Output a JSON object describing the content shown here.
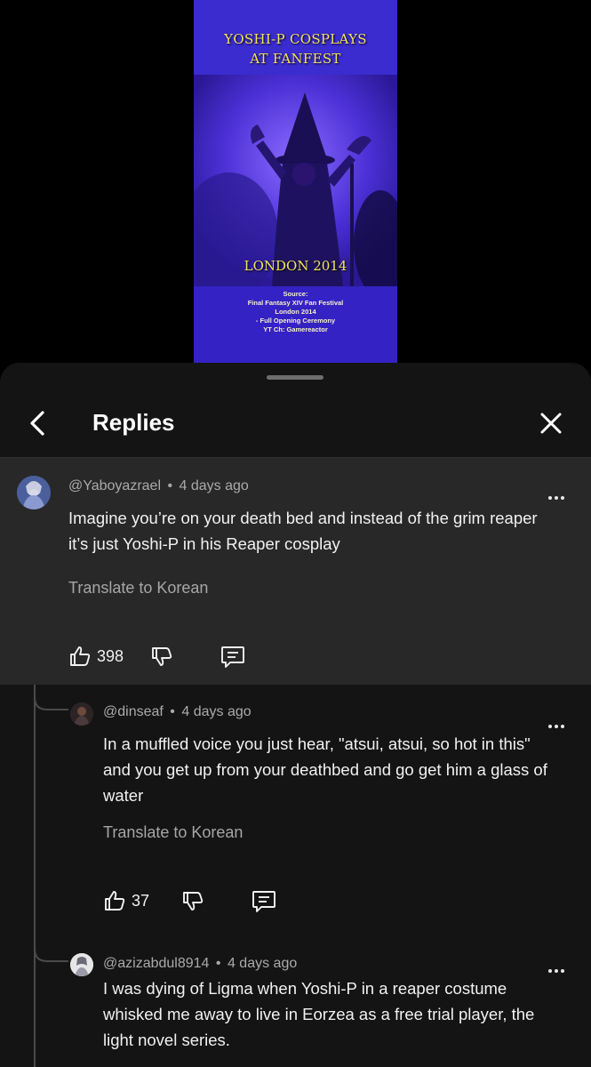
{
  "video": {
    "title_line1": "YOSHI-P COSPLAYS",
    "title_line2": "AT FANFEST",
    "location": "LONDON 2014",
    "source_lines": [
      "Source:",
      "Final Fantasy XIV Fan Festival",
      "London 2014",
      "- Full Opening Ceremony",
      "YT Ch: Gamereactor"
    ]
  },
  "header": {
    "title": "Replies"
  },
  "comment": {
    "author": "@Yaboyazrael",
    "time": "4 days ago",
    "text": "Imagine you’re on your death bed and instead of the grim reaper it’s just Yoshi-P in his Reaper cosplay",
    "translate": "Translate to Korean",
    "likes": "398"
  },
  "replies": [
    {
      "author": "@dinseaf",
      "time": "4 days ago",
      "text": "In a muffled voice you just hear, \"atsui, atsui, so hot in this\" and you get up from your deathbed and go get him a glass of water",
      "translate": "Translate to Korean",
      "likes": "37"
    },
    {
      "author": "@azizabdul8914",
      "time": "4 days ago",
      "text": "I was dying of Ligma when Yoshi-P in a reaper costume whisked me away to live in Eorzea as a free trial player, the light novel series."
    }
  ],
  "separator": "•",
  "colors": {
    "sheet": "#141414",
    "highlight": "#282828",
    "video_title": "#f4e25c",
    "video_bg": "#3a2ccf"
  }
}
